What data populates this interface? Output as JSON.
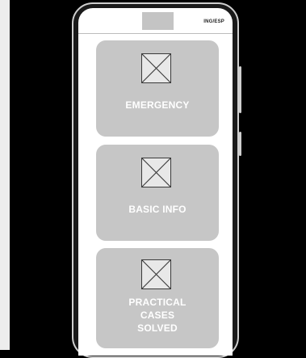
{
  "header": {
    "language_toggle": "ING/ESP",
    "logo_icon": "image-placeholder"
  },
  "menu": {
    "items": [
      {
        "label": "EMERGENCY",
        "icon": "image-placeholder-icon"
      },
      {
        "label": "BASIC INFO",
        "icon": "image-placeholder-icon"
      },
      {
        "label_lines": [
          "PRACTICAL",
          "CASES",
          "SOLVED"
        ],
        "icon": "image-placeholder-icon"
      }
    ]
  },
  "colors": {
    "background": "#000000",
    "screen": "#ffffff",
    "card": "#c6c6c6",
    "card_text": "#ffffff",
    "logo_placeholder": "#c4c4c4"
  }
}
